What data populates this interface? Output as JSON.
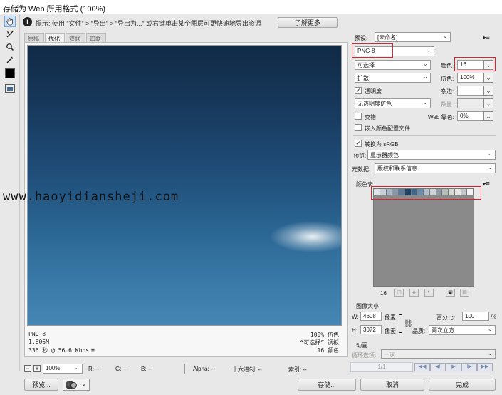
{
  "window": {
    "title": "存储为 Web 所用格式 (100%)"
  },
  "toolbox": {
    "tools": [
      "hand-icon",
      "slice-select-icon",
      "zoom-icon",
      "eyedropper-icon",
      "eyedropper-color-icon",
      "toggle-slices-icon"
    ]
  },
  "hint": {
    "text": "提示: 使用 “文件” > “导出” > “导出为...” 或右键单击某个图层可更快速地导出资源",
    "learn_more": "了解更多"
  },
  "tabs": [
    {
      "label": "原稿"
    },
    {
      "label": "优化"
    },
    {
      "label": "双联"
    },
    {
      "label": "四联"
    }
  ],
  "watermark": "www.haoyidiansheji.com",
  "preview_info": {
    "format": "PNG-8",
    "size": "1.806M",
    "time": "336 秒 @ 56.6 Kbps",
    "menu": "≡",
    "dither": "100% 仿色",
    "palette": "“可选择” 调板",
    "colors": "16 颜色"
  },
  "bottom": {
    "zoom": "100%",
    "r": "R: --",
    "g": "G: --",
    "b": "B: --",
    "alpha": "Alpha: --",
    "hex": "十六进制: --",
    "index": "索引: --"
  },
  "buttons": {
    "preview": "预览...",
    "save": "存储...",
    "cancel": "取消",
    "done": "完成"
  },
  "settings": {
    "preset_label": "预设:",
    "preset_value": "[未命名]",
    "format": "PNG-8",
    "reduction": "可选择",
    "colors_label": "颜色",
    "colors_value": "16",
    "dither_algo": "扩散",
    "dither_label": "仿色:",
    "dither_value": "100%",
    "transparency": "透明度",
    "matte_label": "杂边:",
    "transparency_dither": "无透明度仿色",
    "amount_label": "数量:",
    "interlaced": "交错",
    "web_snap_label": "Web 靠色:",
    "web_snap_value": "0%",
    "embed_profile": "嵌入颜色配置文件",
    "convert_srgb": "转换为 sRGB",
    "preview_label": "预览:",
    "preview_value": "显示器颜色",
    "metadata_label": "元数据:",
    "metadata_value": "版权和联系信息"
  },
  "color_table": {
    "label": "颜色表",
    "count": "16",
    "swatches": [
      "#dfe3e6",
      "#c7cfd6",
      "#a9b6c2",
      "#8799ab",
      "#5f7a94",
      "#1f4466",
      "#3f6688",
      "#6d8ba6",
      "#b2bfcb",
      "#cfd4d5",
      "#8f9aa2",
      "#b4bcb8",
      "#d6d8d2",
      "#e6e6e0",
      "#c1c7c9",
      "#f2f3f1"
    ]
  },
  "image_size": {
    "label": "图像大小",
    "w_label": "W:",
    "w_value": "4608",
    "h_label": "H:",
    "h_value": "3072",
    "unit": "像素",
    "percent_label": "百分比:",
    "percent_value": "100",
    "percent_unit": "%",
    "quality_label": "品质:",
    "quality_value": "两次立方"
  },
  "animation": {
    "label": "动画",
    "loop_label": "循环选项:",
    "loop_value": "一次",
    "frame": "1/1"
  }
}
